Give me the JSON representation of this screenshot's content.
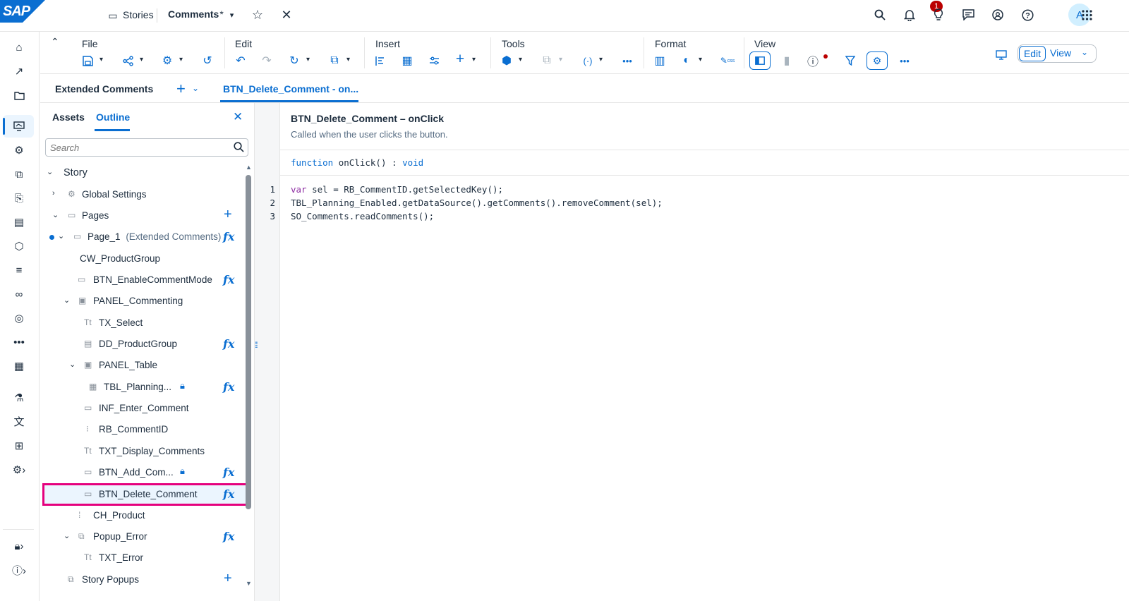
{
  "shell": {
    "logo": "SAP",
    "stories_label": "Stories",
    "doc_title": "Comments",
    "doc_modified": "*",
    "notification_count": "1",
    "avatar_initial": "A"
  },
  "toolbar": {
    "groups": {
      "file": "File",
      "edit": "Edit",
      "insert": "Insert",
      "tools": "Tools",
      "format": "Format",
      "view": "View"
    },
    "edit_button": "Edit",
    "view_button": "View"
  },
  "tabs": {
    "story_title": "Extended Comments",
    "script_tab": "BTN_Delete_Comment - on..."
  },
  "left_panel": {
    "tab_assets": "Assets",
    "tab_outline": "Outline",
    "search_placeholder": "Search",
    "tree": [
      {
        "label": "Story"
      },
      {
        "label": "Global Settings"
      },
      {
        "label": "Pages"
      },
      {
        "label": "Page_1",
        "sub": "(Extended Comments)"
      },
      {
        "label": "CW_ProductGroup"
      },
      {
        "label": "BTN_EnableCommentMode"
      },
      {
        "label": "PANEL_Commenting"
      },
      {
        "label": "TX_Select"
      },
      {
        "label": "DD_ProductGroup"
      },
      {
        "label": "PANEL_Table"
      },
      {
        "label": "TBL_Planning..."
      },
      {
        "label": "INF_Enter_Comment"
      },
      {
        "label": "RB_CommentID"
      },
      {
        "label": "TXT_Display_Comments"
      },
      {
        "label": "BTN_Add_Com..."
      },
      {
        "label": "BTN_Delete_Comment"
      },
      {
        "label": "CH_Product"
      },
      {
        "label": "Popup_Error"
      },
      {
        "label": "TXT_Error"
      },
      {
        "label": "Story Popups"
      }
    ]
  },
  "editor": {
    "title": "BTN_Delete_Comment – onClick",
    "description": "Called when the user clicks the button.",
    "signature": {
      "keyword": "function",
      "name": "onClick() : ",
      "return_type": "void"
    },
    "lines": [
      {
        "num": "1",
        "kw": "var",
        "rest": " sel = RB_CommentID.getSelectedKey();"
      },
      {
        "num": "2",
        "kw": "",
        "rest": "TBL_Planning_Enabled.getDataSource().getComments().removeComment(sel);"
      },
      {
        "num": "3",
        "kw": "",
        "rest": "SO_Comments.readComments();"
      }
    ]
  },
  "colors": {
    "accent": "#0a6ed1",
    "highlight_border": "#e5007d",
    "notification_badge": "#bb0000"
  }
}
